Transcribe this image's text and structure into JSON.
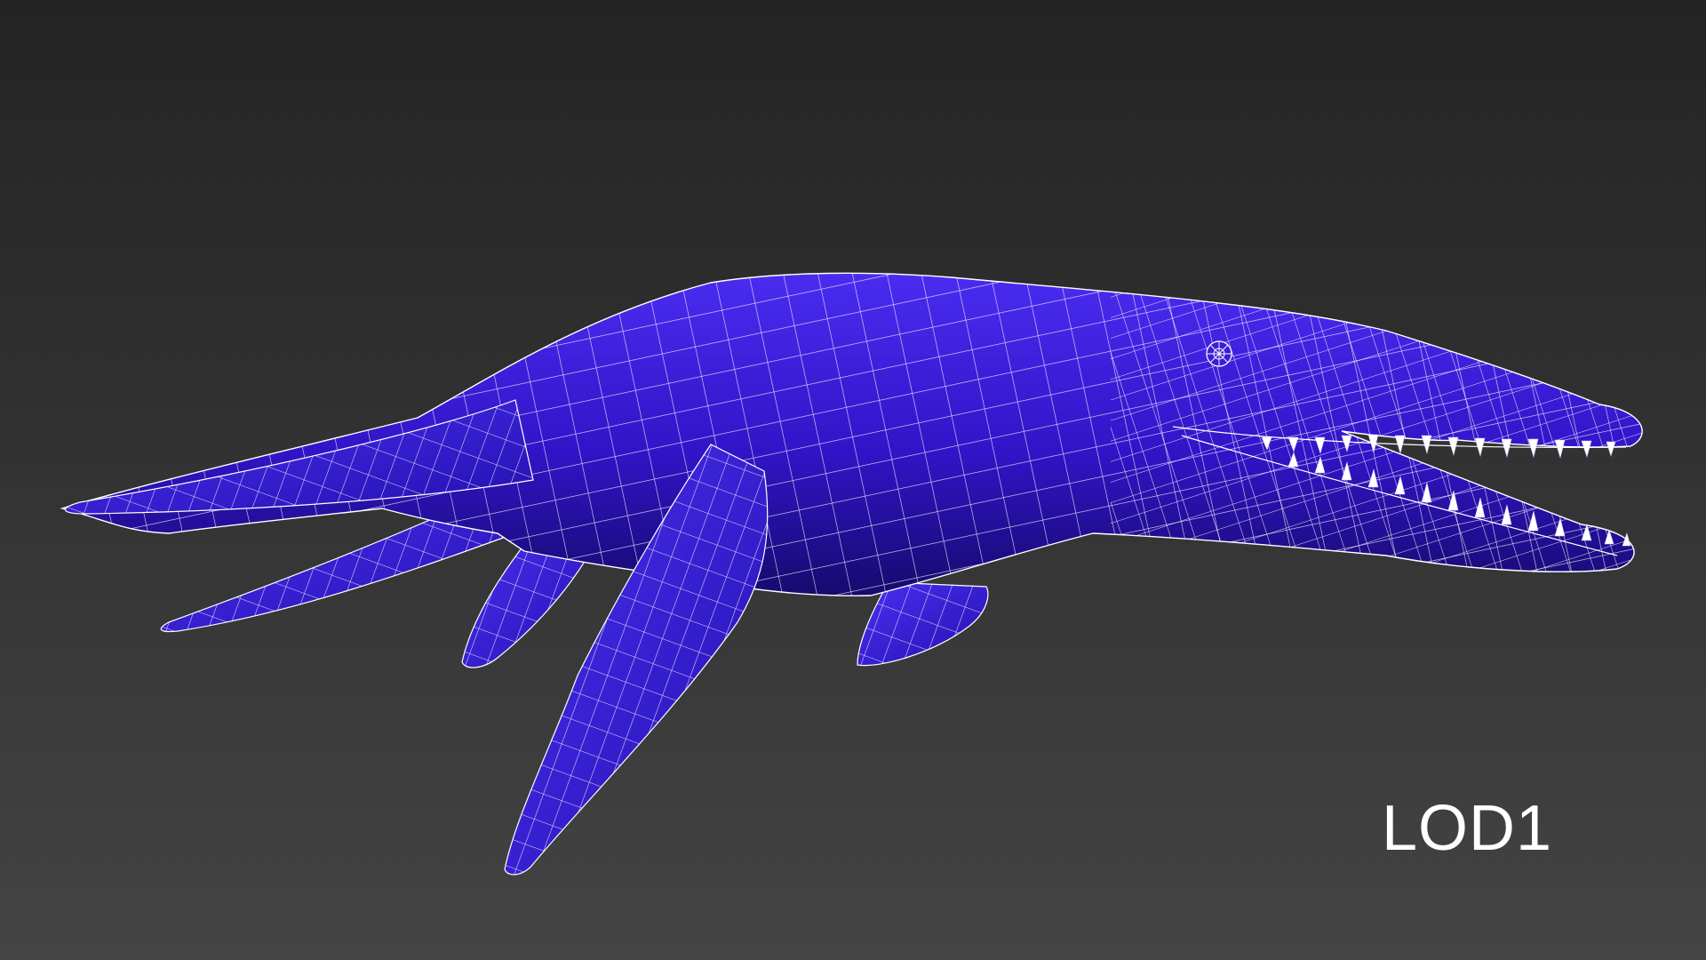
{
  "viewport": {
    "background_top": "#242424",
    "background_bottom": "#444444"
  },
  "model": {
    "icon": "wireframe-mesh",
    "mesh_color": "#3a1fd6",
    "shade_color": "#1c0f8a",
    "wire_color": "#ffffff"
  },
  "label": {
    "lod_text": "LOD1",
    "color": "#ffffff"
  }
}
